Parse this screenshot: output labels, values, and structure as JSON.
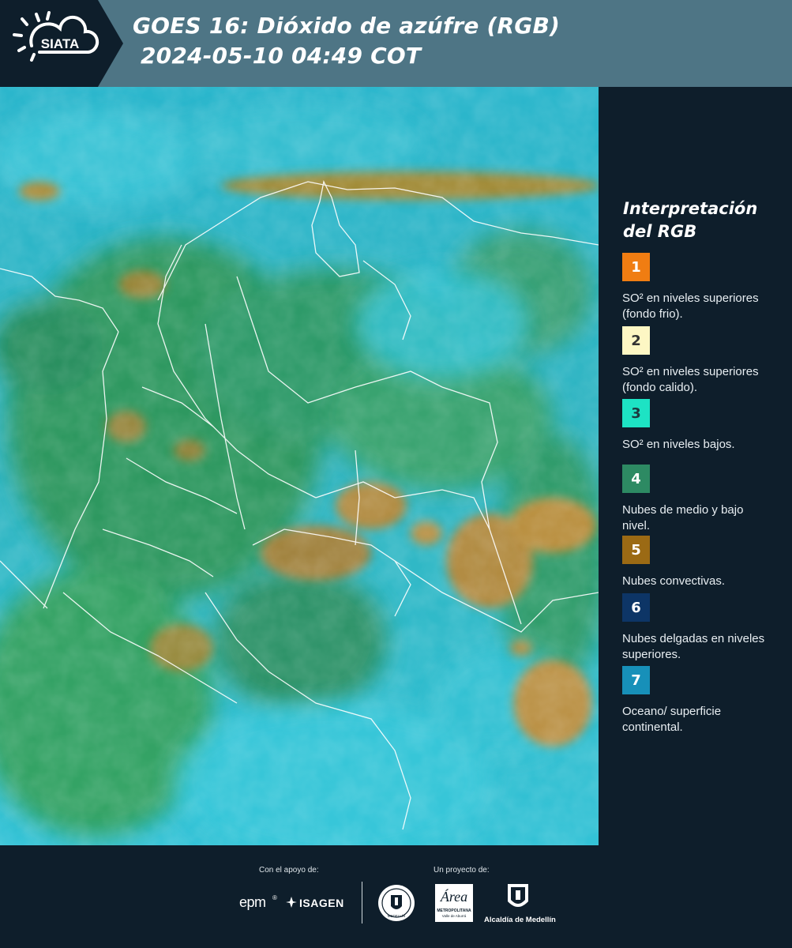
{
  "header": {
    "logo_text": "SIATA",
    "title_line1": "GOES 16: Dióxido de azúfre (RGB)",
    "title_line2": "2024-05-10 04:49 COT"
  },
  "legend": {
    "title_line1": "Interpretación",
    "title_line2": "del RGB",
    "items": [
      {
        "number": "1",
        "color": "#f07d12",
        "text_color": "#ffffff",
        "label": "SO² en niveles superiores (fondo frio)."
      },
      {
        "number": "2",
        "color": "#fdf7c4",
        "text_color": "#333333",
        "label": "SO² en niveles superiores (fondo calido)."
      },
      {
        "number": "3",
        "color": "#1de3c4",
        "text_color": "#1c3b40",
        "label": "SO² en niveles bajos."
      },
      {
        "number": "4",
        "color": "#2d8a63",
        "text_color": "#ffffff",
        "label": "Nubes de medio y bajo nivel."
      },
      {
        "number": "5",
        "color": "#9b6a14",
        "text_color": "#ffffff",
        "label": "Nubes convectivas."
      },
      {
        "number": "6",
        "color": "#0d3566",
        "text_color": "#ffffff",
        "label": "Nubes delgadas en niveles superiores."
      },
      {
        "number": "7",
        "color": "#1790b9",
        "text_color": "#ffffff",
        "label": "Oceano/ superficie continental."
      }
    ]
  },
  "footer": {
    "support_label": "Con el apoyo de:",
    "project_label": "Un proyecto de:",
    "epm": "epm",
    "isagen": "ISAGEN",
    "area_line1": "METROPOLITANA",
    "area_line2": "Valle de Aburrá",
    "area_script": "Área",
    "alcaldia": "Alcaldía de Medellín",
    "medellin_seal": "MEDELLÍN"
  },
  "colors": {
    "header_bg": "#4e7585",
    "logo_bg": "#0e1e2b",
    "panel_bg": "#0e1e2b",
    "map_cyan": "#2cc6d8",
    "map_green": "#2f9a5a",
    "map_ochre": "#b0892f"
  }
}
